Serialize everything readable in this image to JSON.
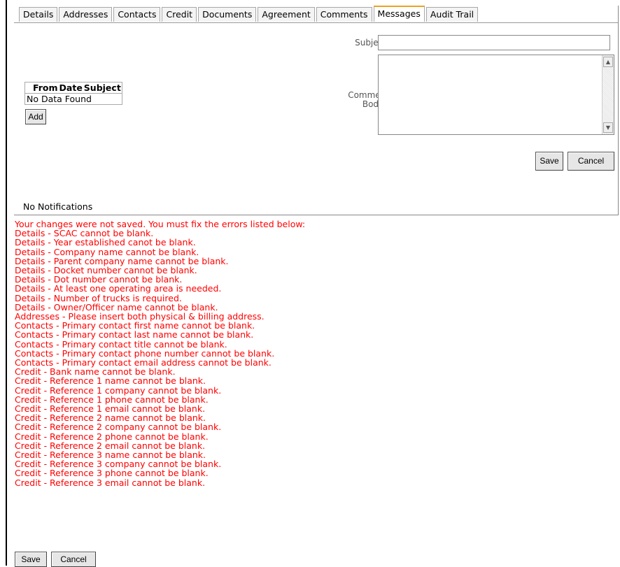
{
  "tabs": [
    {
      "label": "Details",
      "active": false
    },
    {
      "label": "Addresses",
      "active": false
    },
    {
      "label": "Contacts",
      "active": false
    },
    {
      "label": "Credit",
      "active": false
    },
    {
      "label": "Documents",
      "active": false
    },
    {
      "label": "Agreement",
      "active": false
    },
    {
      "label": "Comments",
      "active": false
    },
    {
      "label": "Messages",
      "active": true
    },
    {
      "label": "Audit Trail",
      "active": false
    }
  ],
  "messages": {
    "columns": [
      "From",
      "Date",
      "Subject"
    ],
    "empty_text": "No Data Found",
    "add_label": "Add"
  },
  "form": {
    "subject_label": "Subject:",
    "subject_value": "",
    "comment_label_line1": "Comment",
    "comment_label_line2": "Body :",
    "comment_value": "",
    "save_label": "Save",
    "cancel_label": "Cancel"
  },
  "notifications": "No Notifications",
  "errors": [
    "Your changes were not saved. You must fix the errors listed below:",
    "Details - SCAC cannot be blank.",
    "Details - Year established canot be blank.",
    "Details - Company name cannot be blank.",
    "Details - Parent company name cannot be blank.",
    "Details - Docket number cannot be blank.",
    "Details - Dot number cannot be blank.",
    "Details - At least one operating area is needed.",
    "Details - Number of trucks is required.",
    "Details - Owner/Officer name cannot be blank.",
    "Addresses - Please insert both physical & billing address.",
    "Contacts - Primary contact first name cannot be blank.",
    "Contacts - Primary contact last name cannot be blank.",
    "Contacts - Primary contact title cannot be blank.",
    "Contacts - Primary contact phone number cannot be blank.",
    "Contacts - Primary contact email address cannot be blank.",
    "Credit - Bank name cannot be blank.",
    "Credit - Reference 1 name cannot be blank.",
    "Credit - Reference 1 company cannot be blank.",
    "Credit - Reference 1 phone cannot be blank.",
    "Credit - Reference 1 email cannot be blank.",
    "Credit - Reference 2 name cannot be blank.",
    "Credit - Reference 2 company cannot be blank.",
    "Credit - Reference 2 phone cannot be blank.",
    "Credit - Reference 2 email cannot be blank.",
    "Credit - Reference 3 name cannot be blank.",
    "Credit - Reference 3 company cannot be blank.",
    "Credit - Reference 3 phone cannot be blank.",
    "Credit - Reference 3 email cannot be blank."
  ],
  "footer": {
    "save_label": "Save",
    "cancel_label": "Cancel"
  },
  "colors": {
    "error": "#ff0000",
    "active_tab_accent": "#f0a020"
  }
}
